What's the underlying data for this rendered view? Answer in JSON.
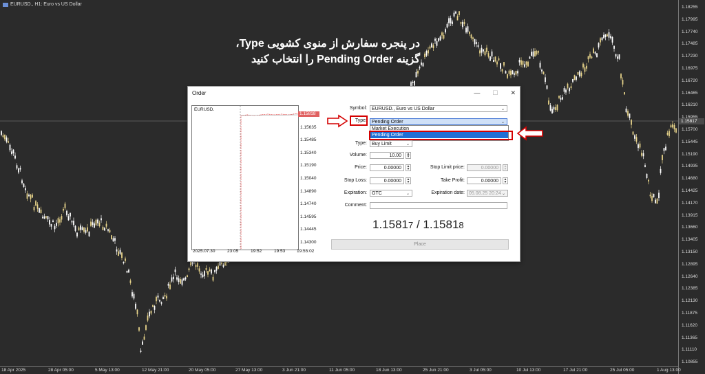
{
  "chart": {
    "header_text": "EURUSD., H1: Euro vs US Dollar",
    "current_price_tag": "1.15817",
    "price_ticks": [
      "1.18255",
      "1.17995",
      "1.17740",
      "1.17485",
      "1.17230",
      "1.16975",
      "1.16720",
      "1.16465",
      "1.16210",
      "1.15955",
      "1.15700",
      "1.15445",
      "1.15190",
      "1.14935",
      "1.14680",
      "1.14425",
      "1.14170",
      "1.13915",
      "1.13660",
      "1.13405",
      "1.13150",
      "1.12895",
      "1.12640",
      "1.12385",
      "1.12130",
      "1.11875",
      "1.11620",
      "1.11365",
      "1.11110",
      "1.10855"
    ],
    "time_ticks": [
      "18 Apr 2025",
      "28 Apr 05:00",
      "5 May 13:00",
      "12 May 21:00",
      "20 May 05:00",
      "27 May 13:00",
      "3 Jun 21:00",
      "11 Jun 05:00",
      "18 Jun 13:00",
      "25 Jun 21:00",
      "3 Jul 05:00",
      "10 Jul 13:00",
      "17 Jul 21:00",
      "25 Jul 05:00",
      "1 Aug 13:00"
    ]
  },
  "annotation": {
    "line1": "در پنجره سفارش از منوی کشویی Type،",
    "line2": "گزینه Pending Order را انتخاب کنید"
  },
  "dialog": {
    "title": "Order",
    "minimize_glyph": "—",
    "maximize_glyph": "☐",
    "close_glyph": "✕",
    "mini_chart": {
      "symbol": "EURUSD.",
      "price_tag": "1.15818",
      "y_labels": [
        "1.15780",
        "1.15635",
        "1.15485",
        "1.15340",
        "1.15190",
        "1.15040",
        "1.14890",
        "1.14740",
        "1.14595",
        "1.14445",
        "1.14300"
      ],
      "x_labels": [
        "2025.07.30",
        "23:05",
        "19:52",
        "19:53",
        "19:55:02"
      ]
    },
    "symbol_label": "Symbol:",
    "symbol_value": "EURUSD., Euro vs US Dollar",
    "type_label": "Type:",
    "type_value": "Pending Order",
    "type_options": [
      "Market Execution",
      "Pending Order"
    ],
    "type2_label": "Type:",
    "type2_value": "Buy Limit",
    "volume_label": "Volume:",
    "volume_value": "10.00",
    "price_label": "Price:",
    "price_value": "0.00000",
    "stop_limit_label": "Stop Limit price:",
    "stop_limit_value": "0.00000",
    "stop_loss_label": "Stop Loss:",
    "stop_loss_value": "0.00000",
    "take_profit_label": "Take Profit:",
    "take_profit_value": "0.00000",
    "expiration_label": "Expiration:",
    "expiration_value": "GTC",
    "expiration_date_label": "Expiration date:",
    "expiration_date_value": "05.08.25 20:24",
    "comment_label": "Comment:",
    "comment_value": "",
    "bid_main": "1.1581",
    "bid_last": "7",
    "separator": " / ",
    "ask_main": "1.1581",
    "ask_last": "8",
    "place_button": "Place"
  },
  "colors": {
    "background": "#2b2b2b",
    "bull": "#e8d48a",
    "bear": "#ffffff",
    "highlight_red": "#d40000",
    "selection_blue": "#1f6fd6"
  },
  "icons": [
    "arrow-right-icon",
    "arrow-left-icon",
    "minimize-icon",
    "maximize-icon",
    "close-icon",
    "dropdown-arrow-icon",
    "spin-up-down-icon"
  ]
}
